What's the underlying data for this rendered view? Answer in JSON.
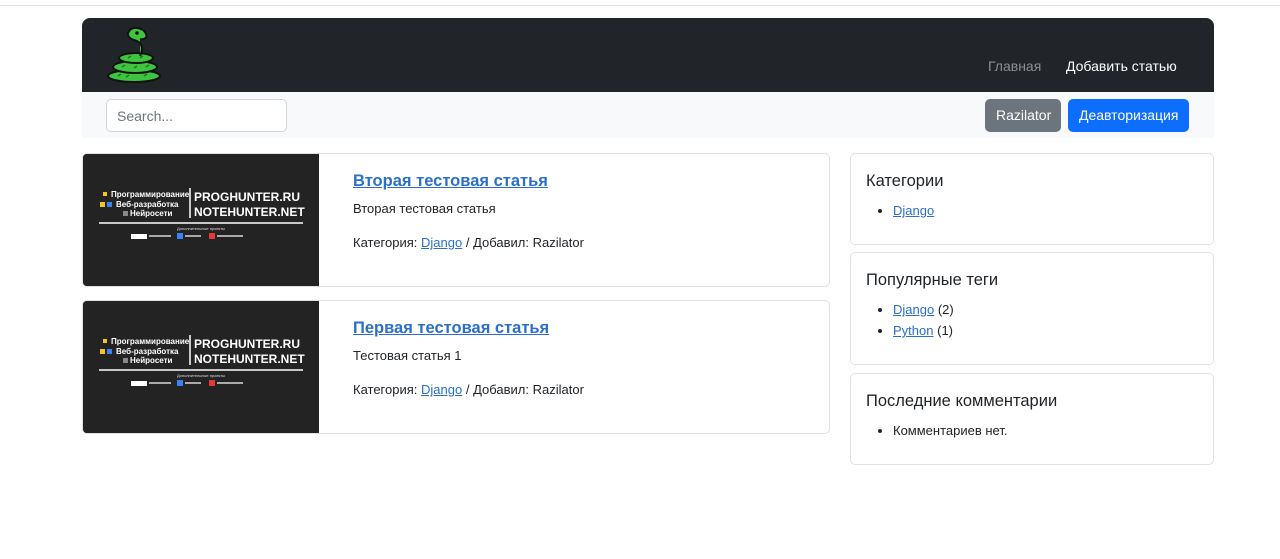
{
  "nav": {
    "home": "Главная",
    "add_article": "Добавить статью"
  },
  "toolbar": {
    "search_placeholder": "Search...",
    "user_button": "Razilator",
    "logout_button": "Деавторизация"
  },
  "articles": [
    {
      "title": "Вторая тестовая статья",
      "description": "Вторая тестовая статья",
      "category_label": "Категория:",
      "category": "Django",
      "author_label": "/ Добавил:",
      "author": "Razilator"
    },
    {
      "title": "Первая тестовая статья",
      "description": "Тестовая статья 1",
      "category_label": "Категория:",
      "category": "Django",
      "author_label": "/ Добавил:",
      "author": "Razilator"
    }
  ],
  "thumbnail": {
    "line1": "Программирование",
    "line2": "Веб-разработка",
    "line3": "Нейросети",
    "site1": "PROGHUNTER.RU",
    "site2": "NOTEHUNTER.NET",
    "sub": "Дополнительные проекты"
  },
  "sidebar": {
    "categories": {
      "title": "Категории",
      "items": [
        "Django"
      ]
    },
    "tags": {
      "title": "Популярные теги",
      "items": [
        {
          "name": "Django",
          "count": "(2)"
        },
        {
          "name": "Python",
          "count": "(1)"
        }
      ]
    },
    "comments": {
      "title": "Последние комментарии",
      "empty": "Комментариев нет."
    }
  },
  "colors": {
    "navbar": "#212529",
    "link": "#2a6fc9",
    "primary": "#0d6efd",
    "secondary": "#6c757d",
    "logo": "#3fc43f"
  }
}
